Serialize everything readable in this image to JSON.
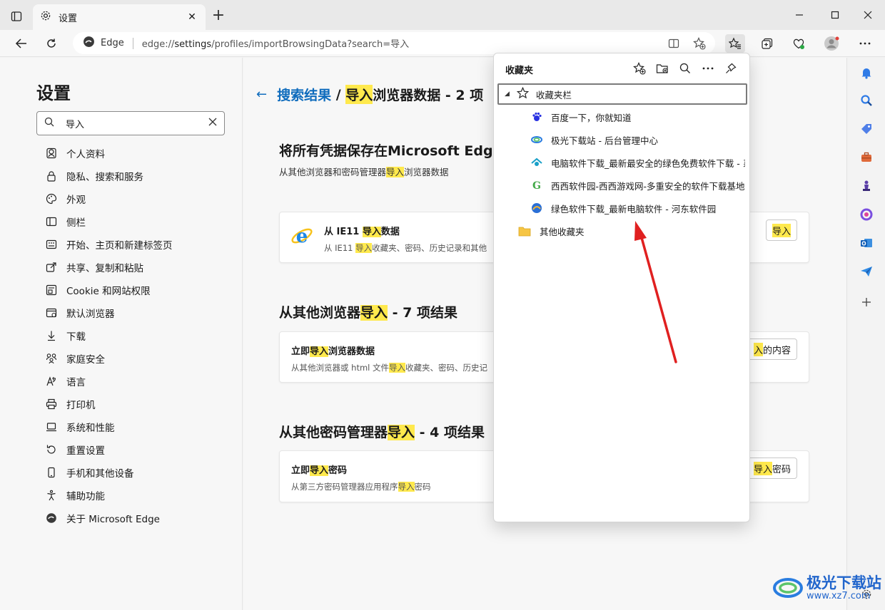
{
  "colors": {
    "accent": "#0f6cbd",
    "highlight": "#ffe94d",
    "arrow": "#e02020"
  },
  "browser": {
    "tab_title": "设置",
    "tab_close": "✕",
    "new_tab": "+",
    "address": {
      "edge_label": "Edge",
      "url_prefix": "edge://",
      "url_host": "settings",
      "url_path": "/profiles/importBrowsingData?search=导入"
    }
  },
  "sidebar": {
    "title": "设置",
    "search_value": "导入",
    "items": [
      {
        "label": "个人资料",
        "icon": "person-icon"
      },
      {
        "label": "隐私、搜索和服务",
        "icon": "lock-icon"
      },
      {
        "label": "外观",
        "icon": "palette-icon"
      },
      {
        "label": "侧栏",
        "icon": "sidebar-icon"
      },
      {
        "label": "开始、主页和新建标签页",
        "icon": "home-icon"
      },
      {
        "label": "共享、复制和粘贴",
        "icon": "share-icon"
      },
      {
        "label": "Cookie 和网站权限",
        "icon": "cookie-icon"
      },
      {
        "label": "默认浏览器",
        "icon": "browser-icon"
      },
      {
        "label": "下载",
        "icon": "download-icon"
      },
      {
        "label": "家庭安全",
        "icon": "family-icon"
      },
      {
        "label": "语言",
        "icon": "language-icon"
      },
      {
        "label": "打印机",
        "icon": "printer-icon"
      },
      {
        "label": "系统和性能",
        "icon": "laptop-icon"
      },
      {
        "label": "重置设置",
        "icon": "reset-icon"
      },
      {
        "label": "手机和其他设备",
        "icon": "phone-icon"
      },
      {
        "label": "辅助功能",
        "icon": "accessibility-icon"
      },
      {
        "label": "关于 Microsoft Edge",
        "icon": "edge-icon"
      }
    ]
  },
  "main": {
    "breadcrumb": {
      "link": "搜索结果",
      "slash": " / ",
      "hl": "导入",
      "rest": "浏览器数据 - 2 项"
    },
    "section1": {
      "title": "将所有凭据保存在Microsoft Edg",
      "sub_pre": "从其他浏览器和密码管理器",
      "sub_hl": "导入",
      "sub_post": "浏览器数据"
    },
    "card1": {
      "title_pre": "从 IE11 ",
      "title_hl": "导入",
      "title_post": "数据",
      "desc_pre": "从 IE11 ",
      "desc_hl": "导入",
      "desc_post": "收藏夹、密码、历史记录和其他",
      "button": "导入"
    },
    "section2": {
      "title_pre": "从其他浏览器",
      "title_hl": "导入",
      "title_post": " - 7 项结果"
    },
    "card2": {
      "title_pre": "立即",
      "title_hl": "导入",
      "title_post": "浏览器数据",
      "desc_pre": "从其他浏览器或 html 文件",
      "desc_hl": "导入",
      "desc_post": "收藏夹、密码、历史记",
      "button_hl": "入",
      "button_post": "的内容"
    },
    "section3": {
      "title_pre": "从其他密码管理器",
      "title_hl": "导入",
      "title_post": " - 4 项结果"
    },
    "card3": {
      "title_pre": "立即",
      "title_hl": "导入",
      "title_post": "密码",
      "desc_pre": "从第三方密码管理器应用程序",
      "desc_hl": "导入",
      "desc_post": "密码",
      "button_hl": "导入",
      "button_post": "密码"
    }
  },
  "favorites": {
    "title": "收藏夹",
    "bar_label": "收藏夹栏",
    "items": [
      {
        "label": "百度一下，你就知道",
        "icon": "baidu-icon"
      },
      {
        "label": "极光下载站 - 后台管理中心",
        "icon": "aurora-icon"
      },
      {
        "label": "电脑软件下载_最新最安全的绿色免费软件下载 - 系",
        "icon": "pcsoft-icon"
      },
      {
        "label": "西西软件园-西西游戏网-多重安全的软件下载基地",
        "icon": "xixi-icon"
      },
      {
        "label": "绿色软件下载_最新电脑软件 - 河东软件园",
        "icon": "hedong-icon"
      }
    ],
    "other_folder": "其他收藏夹"
  },
  "watermark": {
    "name": "极光下载站",
    "url": "www.xz7.com"
  }
}
